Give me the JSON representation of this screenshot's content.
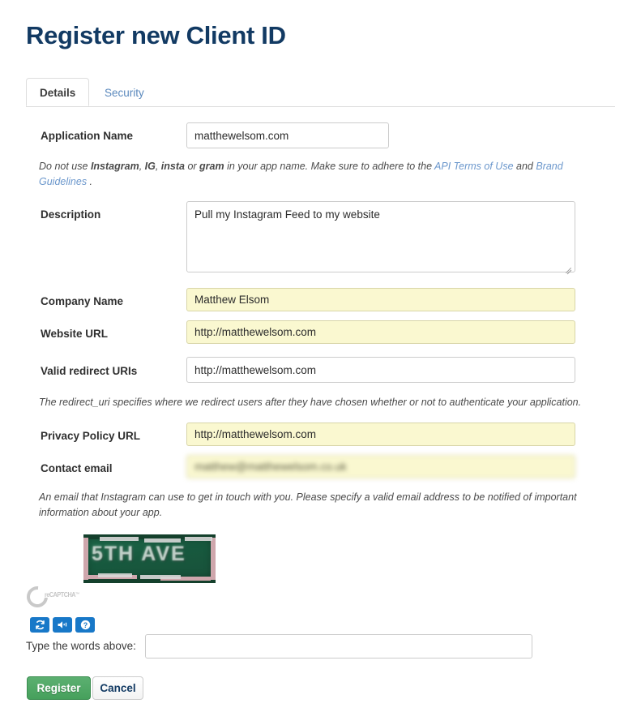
{
  "page": {
    "title": "Register new Client ID",
    "title_color": "#123a63"
  },
  "tabs": [
    {
      "label": "Details",
      "active": true
    },
    {
      "label": "Security",
      "active": false
    }
  ],
  "form": {
    "application_name": {
      "label": "Application Name",
      "value": "matthewelsom.com",
      "placeholder": "",
      "autofilled": false
    },
    "application_name_help": {
      "prefix": "Do not use ",
      "term1": "Instagram",
      "sep1": ", ",
      "term2": "IG",
      "sep2": ", ",
      "term3": "insta",
      "sep3": " or ",
      "term4": "gram",
      "middle": " in your app name. Make sure to adhere to the ",
      "link1": "API Terms of Use",
      "conj": " and ",
      "link2": "Brand Guidelines",
      "suffix": " ."
    },
    "description": {
      "label": "Description",
      "value": "Pull my Instagram Feed to my website",
      "placeholder": "",
      "autofilled": false
    },
    "company_name": {
      "label": "Company Name",
      "value": "Matthew Elsom",
      "placeholder": "",
      "autofilled": true
    },
    "website_url": {
      "label": "Website URL",
      "value": "http://matthewelsom.com",
      "placeholder": "",
      "autofilled": true
    },
    "valid_redirect_uris": {
      "label": "Valid redirect URIs",
      "value": "http://matthewelsom.com",
      "placeholder": "",
      "autofilled": false
    },
    "redirect_help": "The redirect_uri specifies where we redirect users after they have chosen whether or not to authenticate your application.",
    "privacy_policy_url": {
      "label": "Privacy Policy URL",
      "value": "http://matthewelsom.com",
      "placeholder": "",
      "autofilled": true
    },
    "contact_email": {
      "label": "Contact email",
      "value": "matthew@matthewelsom.co.uk",
      "placeholder": "",
      "autofilled": true,
      "redacted": true
    },
    "contact_email_help": "An email that Instagram can use to get in touch with you. Please specify a valid email address to be notified of important information about your app."
  },
  "captcha": {
    "challenge_text": "5TH AVE",
    "logo_text": "reCAPTCHA",
    "logo_tm": "™",
    "buttons": [
      {
        "name": "refresh",
        "title": "Get a new challenge"
      },
      {
        "name": "audio",
        "title": "Get an audio challenge"
      },
      {
        "name": "help",
        "title": "Help"
      }
    ],
    "input_label": "Type the words above:",
    "input_value": "",
    "input_placeholder": "",
    "accent_color": "#1878c8"
  },
  "actions": {
    "register_label": "Register",
    "cancel_label": "Cancel",
    "register_color": "#46a05c"
  }
}
